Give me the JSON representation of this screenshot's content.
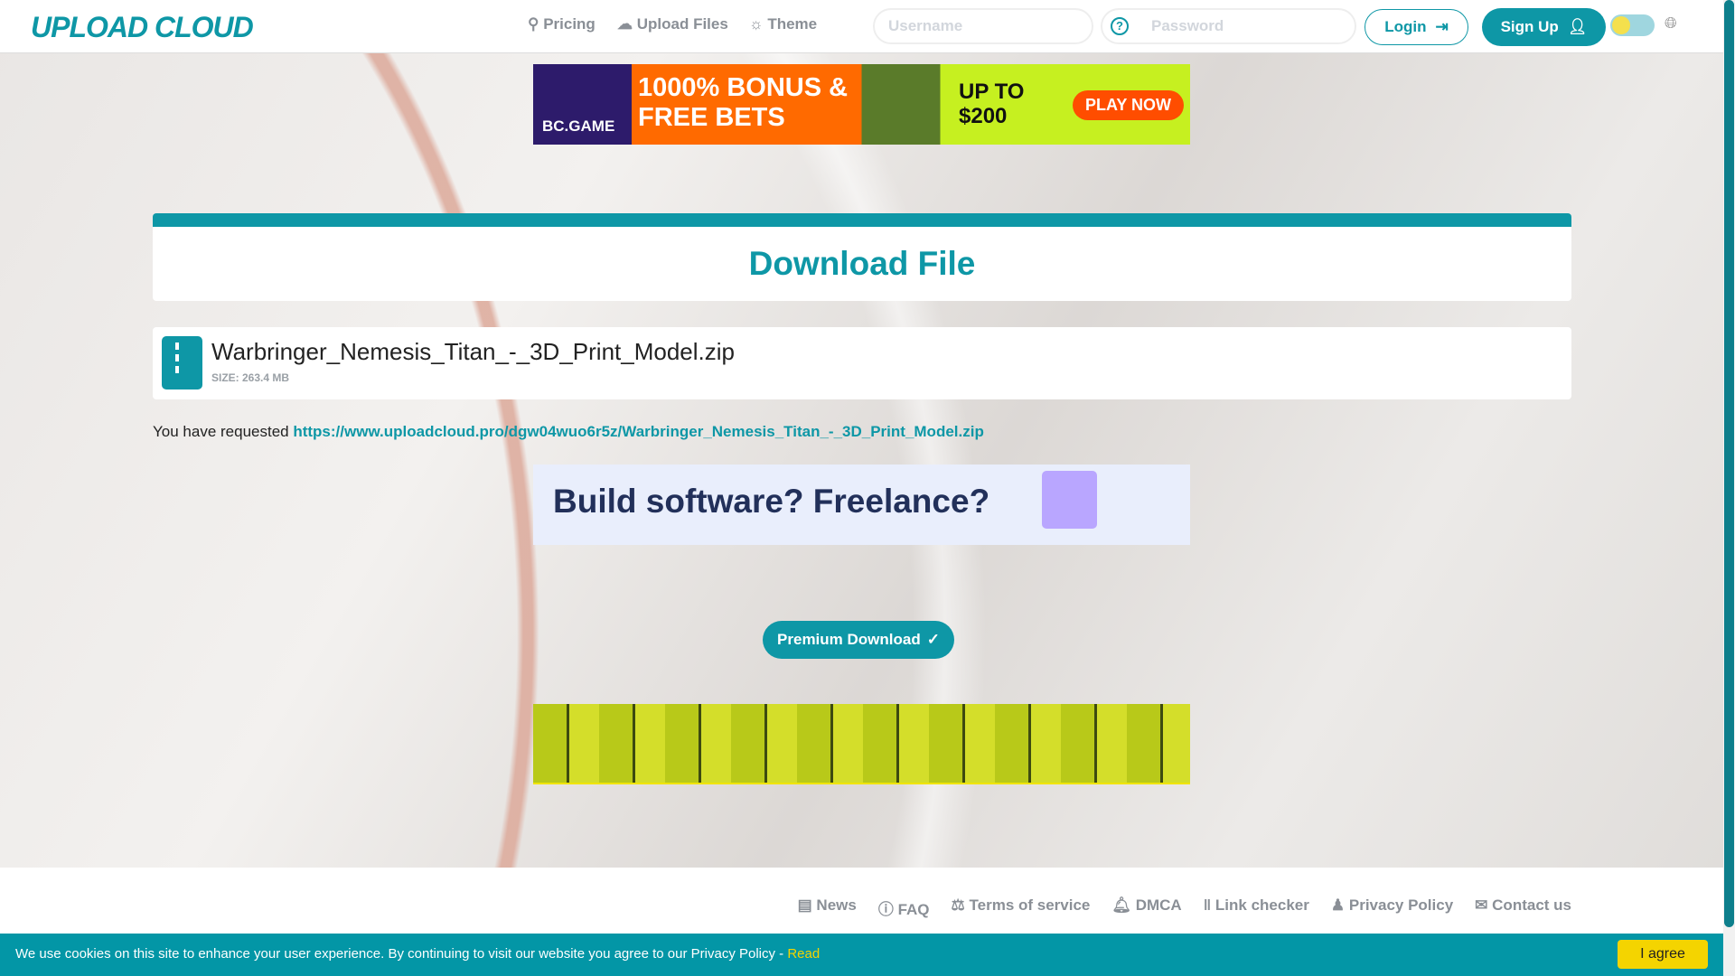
{
  "header": {
    "logo": "UPLOAD CLOUD",
    "nav": [
      {
        "icon": "award-icon",
        "label": "Pricing"
      },
      {
        "icon": "cloud-upload-icon",
        "label": "Upload Files"
      },
      {
        "icon": "theme-icon",
        "label": "Theme"
      }
    ],
    "username_placeholder": "Username",
    "password_placeholder": "Password",
    "login": "Login",
    "signup": "Sign Up"
  },
  "ads": {
    "top": {
      "brand": "BC.GAME",
      "headline": "1000% BONUS & FREE BETS",
      "amount": "UP TO $200",
      "cta": "PLAY NOW"
    },
    "middle": {
      "headline": "Build software? Freelance?"
    }
  },
  "main": {
    "title": "Download File",
    "file_name": "Warbringer_Nemesis_Titan_-_3D_Print_Model.zip",
    "file_size": "SIZE: 263.4 MB",
    "requested_prefix": "You have requested",
    "requested_url": "https://www.uploadcloud.pro/dgw04wuo6r5z/Warbringer_Nemesis_Titan_-_3D_Print_Model.zip",
    "premium": "Premium Download"
  },
  "footer": {
    "links": [
      {
        "icon": "news-icon",
        "label": "News"
      },
      {
        "icon": "question-icon",
        "label": "FAQ"
      },
      {
        "icon": "scale-icon",
        "label": "Terms of service"
      },
      {
        "icon": "bell-icon",
        "label": "DMCA"
      },
      {
        "icon": "barcode-icon",
        "label": "Link checker"
      },
      {
        "icon": "user-secret-icon",
        "label": "Privacy Policy"
      },
      {
        "icon": "envelope-icon",
        "label": "Contact us"
      }
    ]
  },
  "cookie": {
    "message": "We use cookies on this site to enhance your user experience. By continuing to visit our website you agree to our Privacy Policy - ",
    "read": "Read",
    "agree": "I agree"
  }
}
